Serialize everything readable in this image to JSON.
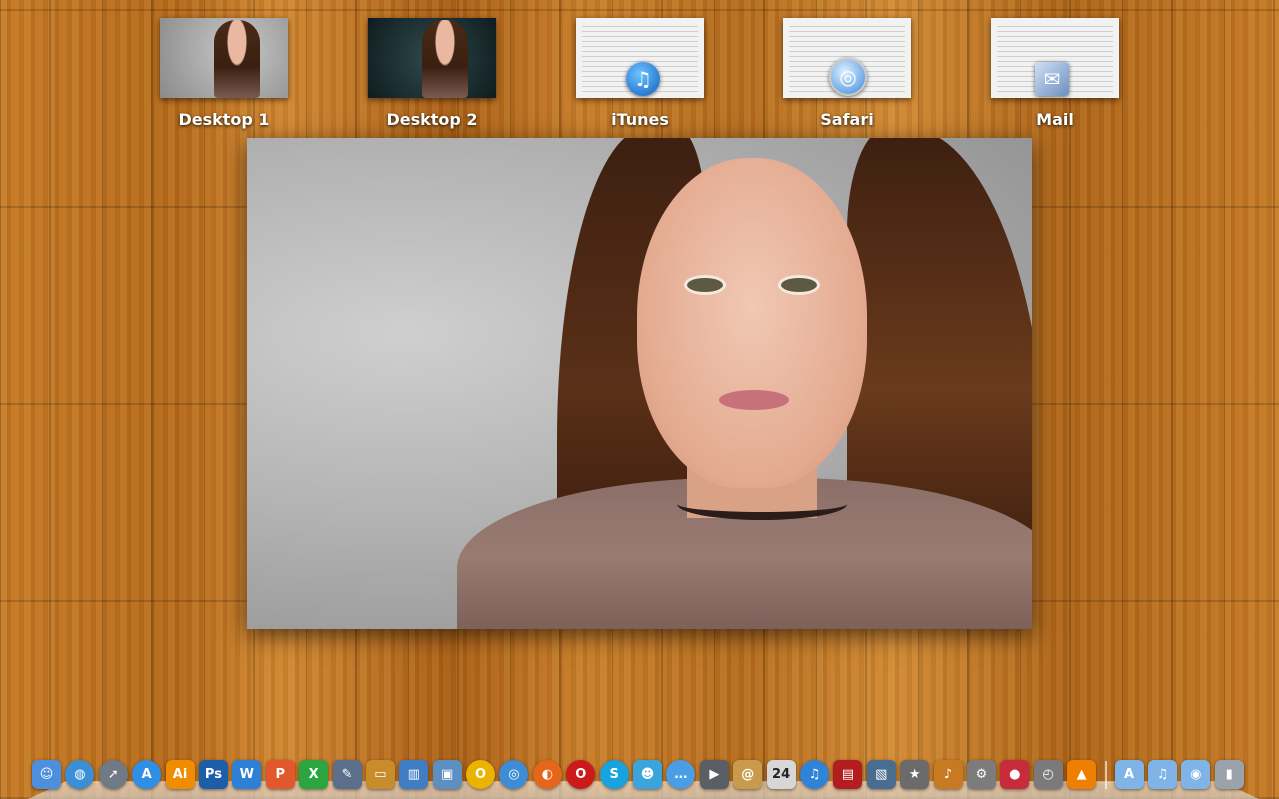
{
  "spaces": [
    {
      "label": "Desktop 1",
      "kind": "photo-light"
    },
    {
      "label": "Desktop 2",
      "kind": "photo-dark"
    },
    {
      "label": "iTunes",
      "kind": "app-window",
      "badge": "itunes",
      "glyph": "♫"
    },
    {
      "label": "Safari",
      "kind": "app-window",
      "badge": "safari",
      "glyph": "◎"
    },
    {
      "label": "Mail",
      "kind": "app-window",
      "badge": "mail",
      "glyph": "✉"
    }
  ],
  "dock": {
    "apps": [
      {
        "name": "finder-icon",
        "glyph": "☺",
        "color": "#4d8fdc"
      },
      {
        "name": "globe-icon",
        "glyph": "◍",
        "color": "#3a8fd6",
        "round": true
      },
      {
        "name": "launchpad-icon",
        "glyph": "➚",
        "color": "#6f7a86",
        "round": true
      },
      {
        "name": "app-store-icon",
        "glyph": "A",
        "color": "#2f8fe6",
        "round": true
      },
      {
        "name": "illustrator-icon",
        "glyph": "Ai",
        "color": "#f08c00"
      },
      {
        "name": "photoshop-icon",
        "glyph": "Ps",
        "color": "#1c5fa8"
      },
      {
        "name": "word-icon",
        "glyph": "W",
        "color": "#2e7fd6"
      },
      {
        "name": "powerpoint-icon",
        "glyph": "P",
        "color": "#e2572b"
      },
      {
        "name": "excel-icon",
        "glyph": "X",
        "color": "#2aa540"
      },
      {
        "name": "pen-icon",
        "glyph": "✎",
        "color": "#5b6f8c"
      },
      {
        "name": "keynote-icon",
        "glyph": "▭",
        "color": "#c98c2a"
      },
      {
        "name": "chart-icon",
        "glyph": "▥",
        "color": "#3f7ec4"
      },
      {
        "name": "preview-icon",
        "glyph": "▣",
        "color": "#5d8fc1"
      },
      {
        "name": "ring-icon",
        "glyph": "O",
        "color": "#e9b300",
        "round": true
      },
      {
        "name": "compass-icon",
        "glyph": "◎",
        "color": "#3e8bd6",
        "round": true
      },
      {
        "name": "firefox-icon",
        "glyph": "◐",
        "color": "#e5661b",
        "round": true
      },
      {
        "name": "opera-icon",
        "glyph": "O",
        "color": "#cc1a1a",
        "round": true
      },
      {
        "name": "skype-icon",
        "glyph": "S",
        "color": "#17a3e0",
        "round": true
      },
      {
        "name": "contacts-icon",
        "glyph": "☻",
        "color": "#3ba4dc"
      },
      {
        "name": "chat-icon",
        "glyph": "…",
        "color": "#4a9ee6",
        "round": true
      },
      {
        "name": "facetime-icon",
        "glyph": "▶",
        "color": "#5a5f66"
      },
      {
        "name": "address-book-icon",
        "glyph": "@",
        "color": "#c79a4c"
      },
      {
        "name": "calendar-icon",
        "glyph": "24",
        "color": "#d7d7d7"
      },
      {
        "name": "itunes-icon",
        "glyph": "♫",
        "color": "#2f84d8",
        "round": true
      },
      {
        "name": "photo-booth-icon",
        "glyph": "▤",
        "color": "#b31d1d"
      },
      {
        "name": "iphoto-icon",
        "glyph": "▧",
        "color": "#4a6c8e"
      },
      {
        "name": "imovie-icon",
        "glyph": "★",
        "color": "#6b6b6b"
      },
      {
        "name": "garageband-icon",
        "glyph": "♪",
        "color": "#c87a22"
      },
      {
        "name": "system-preferences-icon",
        "glyph": "⚙",
        "color": "#7c7c7c"
      },
      {
        "name": "stamp-icon",
        "glyph": "●",
        "color": "#c72b3c"
      },
      {
        "name": "time-machine-icon",
        "glyph": "◴",
        "color": "#7a7a7a"
      },
      {
        "name": "vlc-icon",
        "glyph": "▲",
        "color": "#ee7f00"
      }
    ],
    "folders": [
      {
        "name": "applications-folder-icon",
        "glyph": "A",
        "color": "#7fb5e6"
      },
      {
        "name": "music-folder-icon",
        "glyph": "♫",
        "color": "#7fb5e6"
      },
      {
        "name": "downloads-folder-icon",
        "glyph": "◉",
        "color": "#7fb5e6"
      },
      {
        "name": "trash-icon",
        "glyph": "▮",
        "color": "#9aa3ab"
      }
    ]
  }
}
